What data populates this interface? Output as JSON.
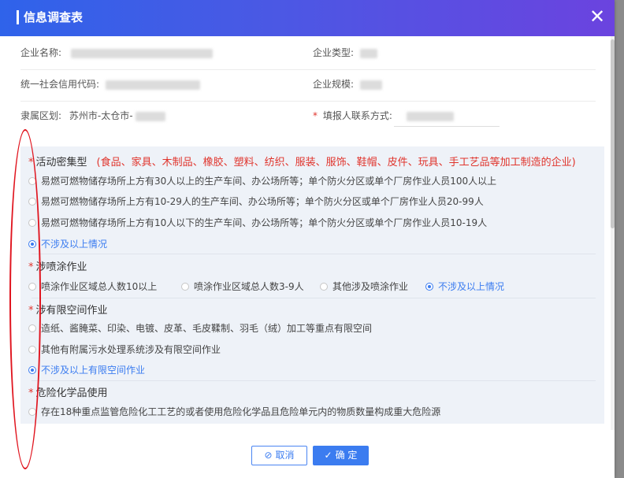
{
  "dialog": {
    "title": "信息调查表",
    "close": "✕"
  },
  "info": {
    "company_name_label": "企业名称:",
    "company_type_label": "企业类型:",
    "credit_code_label": "统一社会信用代码:",
    "scale_label": "企业规模:",
    "district_label": "隶属区划:",
    "district_value": "苏州市-太仓市-",
    "contact_label": "填报人联系方式:",
    "required_mark": "*"
  },
  "questions": [
    {
      "title": "活动密集型",
      "note": "(食品、家具、木制品、橡胶、塑料、纺织、服装、服饰、鞋帽、皮件、玩具、手工艺品等加工制造的企业)",
      "options": [
        {
          "label": "易燃可燃物储存场所上方有30人以上的生产车间、办公场所等；单个防火分区或单个厂房作业人员100人以上",
          "selected": false
        },
        {
          "label": "易燃可燃物储存场所上方有10-29人的生产车间、办公场所等；单个防火分区或单个厂房作业人员20-99人",
          "selected": false
        },
        {
          "label": "易燃可燃物储存场所上方有10人以下的生产车间、办公场所等；单个防火分区或单个厂房作业人员10-19人",
          "selected": false
        },
        {
          "label": "不涉及以上情况",
          "selected": true
        }
      ]
    },
    {
      "title": "涉喷涂作业",
      "options": [
        {
          "label": "喷涂作业区域总人数10以上",
          "selected": false
        },
        {
          "label": "喷涂作业区域总人数3-9人",
          "selected": false
        },
        {
          "label": "其他涉及喷涂作业",
          "selected": false
        },
        {
          "label": "不涉及以上情况",
          "selected": true
        }
      ]
    },
    {
      "title": "涉有限空间作业",
      "options": [
        {
          "label": "造纸、酱腌菜、印染、电镀、皮革、毛皮鞣制、羽毛（绒）加工等重点有限空间",
          "selected": false
        },
        {
          "label": "其他有附属污水处理系统涉及有限空间作业",
          "selected": false
        },
        {
          "label": "不涉及以上有限空间作业",
          "selected": true
        }
      ]
    },
    {
      "title": "危险化学品使用",
      "options": [
        {
          "label": "存在18种重点监管危险化工工艺的或者使用危险化学品且危险单元内的物质数量构成重大危险源",
          "selected": false
        }
      ]
    }
  ],
  "buttons": {
    "cancel": "取消",
    "confirm": "确 定"
  },
  "colors": {
    "accent": "#3b7cf0",
    "required": "#e0342c",
    "annotation": "#e0141e"
  }
}
